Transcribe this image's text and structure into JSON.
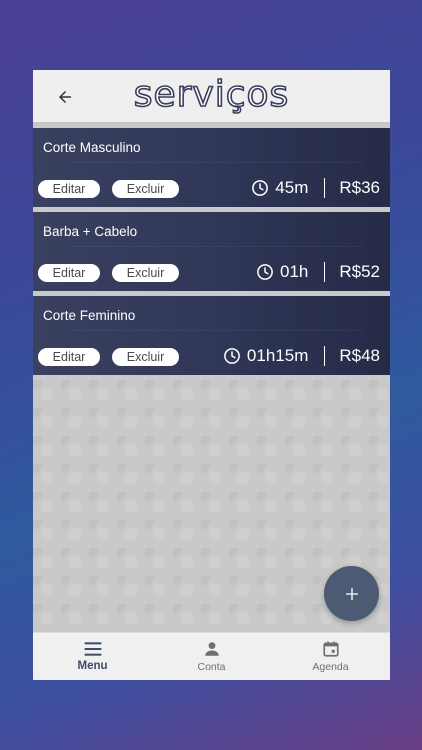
{
  "header": {
    "title": "serviços",
    "back_icon": "arrow-back-icon"
  },
  "services": [
    {
      "name": "Corte Masculino",
      "edit_label": "Editar",
      "delete_label": "Excluir",
      "duration": "45m",
      "price": "R$36"
    },
    {
      "name": "Barba + Cabelo",
      "edit_label": "Editar",
      "delete_label": "Excluir",
      "duration": "01h",
      "price": "R$52"
    },
    {
      "name": "Corte Feminino",
      "edit_label": "Editar",
      "delete_label": "Excluir",
      "duration": "01h15m",
      "price": "R$48"
    }
  ],
  "fab": {
    "icon": "plus-icon"
  },
  "nav": {
    "items": [
      {
        "label": "Menu",
        "icon": "menu-icon",
        "active": true
      },
      {
        "label": "Conta",
        "icon": "person-icon",
        "active": false
      },
      {
        "label": "Agenda",
        "icon": "calendar-icon",
        "active": false
      }
    ]
  },
  "colors": {
    "card_dark": "#252b47",
    "header_bg": "#efefef",
    "fab_bg": "#4d5a73",
    "nav_active": "#3f4a6b"
  }
}
